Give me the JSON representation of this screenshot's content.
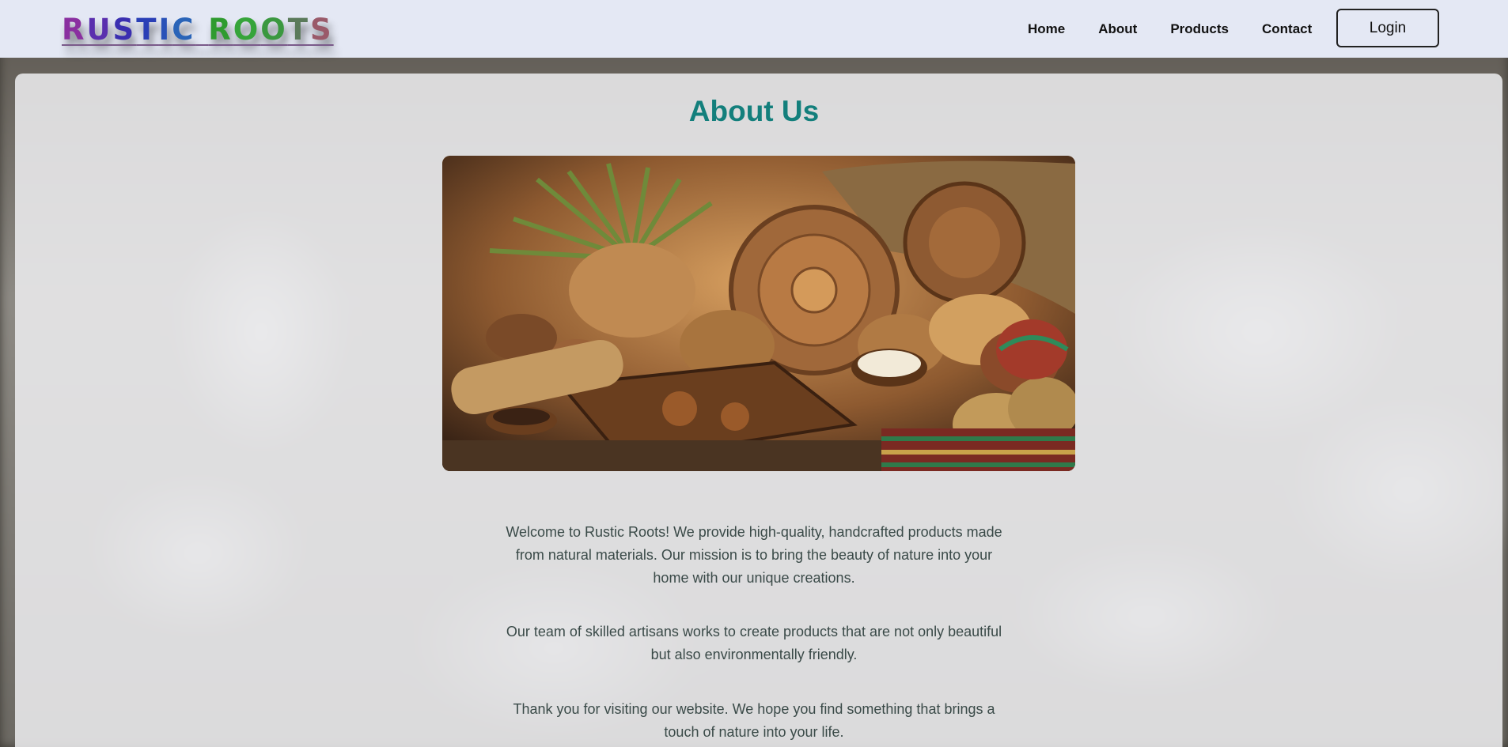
{
  "header": {
    "logo_text": "RUSTIC ROOTS",
    "nav": [
      "Home",
      "About",
      "Products",
      "Contact"
    ],
    "login_label": "Login"
  },
  "main": {
    "title": "About Us",
    "hero_image_icon": "handcrafted-goods-image",
    "paragraphs": [
      [
        "Welcome to Rustic Roots! We provide high-quality, handcrafted products made",
        "from natural materials. Our mission is to bring the beauty of nature into your",
        "home with our unique creations."
      ],
      [
        "Our team of skilled artisans works to create products that are not only beautiful",
        "but also environmentally friendly."
      ],
      [
        "Thank you for visiting our website. We hope you find something that brings a",
        "touch of nature into your life."
      ]
    ]
  },
  "colors": {
    "header_bg": "#e4e8f4",
    "title": "#137f7c",
    "body_text": "#3a4a48"
  }
}
